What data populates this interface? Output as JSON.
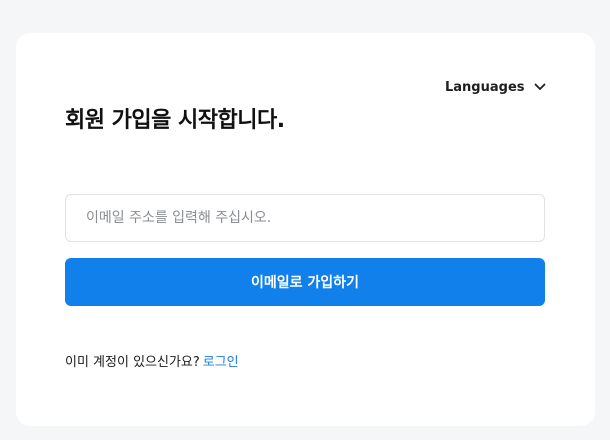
{
  "language_selector": {
    "label": "Languages",
    "icon": "chevron-down-icon"
  },
  "heading": "회원 가입을 시작합니다.",
  "email_input": {
    "value": "",
    "placeholder": "이메일 주소를 입력해 주십시오."
  },
  "submit_button": {
    "label": "이메일로 가입하기",
    "color": "#1180ea"
  },
  "login_prompt": {
    "text": "이미 계정이 있으신가요?",
    "link_label": "로그인",
    "link_color": "#1a7fd6"
  }
}
